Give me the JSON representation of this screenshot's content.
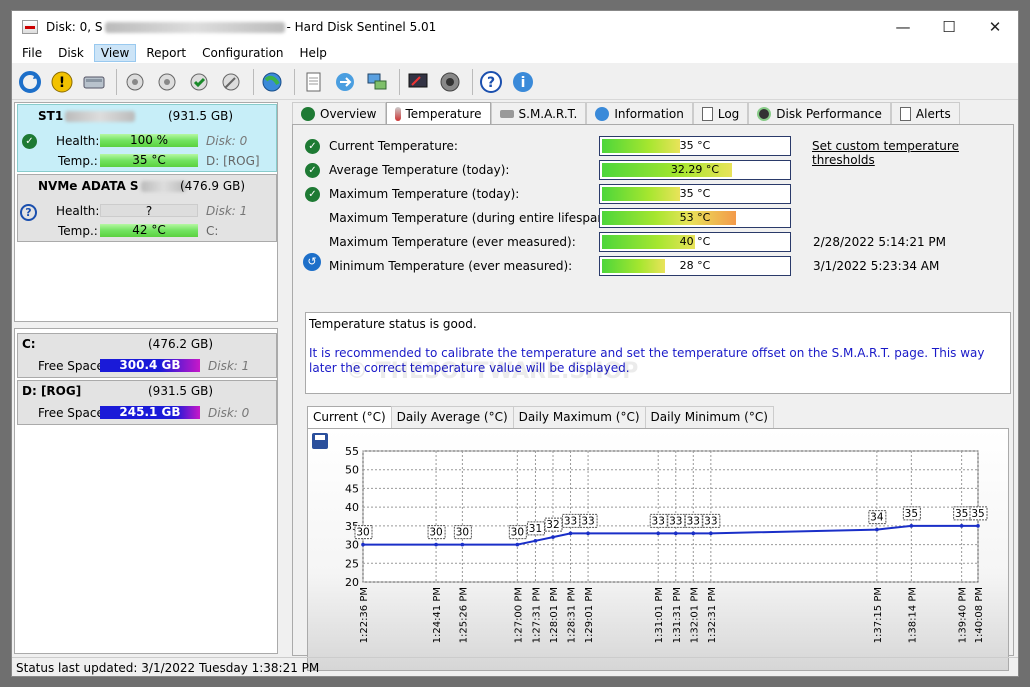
{
  "window": {
    "title_prefix": "Disk: 0, S",
    "title_suffix": "- Hard Disk Sentinel 5.01",
    "min": "—",
    "max": "☐",
    "close": "✕"
  },
  "menu": [
    "File",
    "Disk",
    "View",
    "Report",
    "Configuration",
    "Help"
  ],
  "disks": [
    {
      "title": "ST1",
      "size": "(931.5 GB)",
      "health_label": "Health:",
      "health": "100 %",
      "temp_label": "Temp.:",
      "temp": "35 °C",
      "disk_ref": "Disk: 0",
      "drive": "D: [ROG]"
    },
    {
      "title": "NVMe   ADATA S",
      "size": "(476.9 GB)",
      "health_label": "Health:",
      "health": "?",
      "temp_label": "Temp.:",
      "temp": "42 °C",
      "disk_ref": "Disk: 1",
      "drive": "C:"
    }
  ],
  "volumes": [
    {
      "name": "C:",
      "size": "(476.2 GB)",
      "free_label": "Free Space",
      "free": "300.4 GB",
      "disk_ref": "Disk: 1"
    },
    {
      "name": "D: [ROG]",
      "size": "(931.5 GB)",
      "free_label": "Free Space",
      "free": "245.1 GB",
      "disk_ref": "Disk: 0"
    }
  ],
  "tabs": [
    "Overview",
    "Temperature",
    "S.M.A.R.T.",
    "Information",
    "Log",
    "Disk Performance",
    "Alerts"
  ],
  "temps": [
    {
      "label": "Current Temperature:",
      "value": "35",
      "unit": "°C",
      "fill": 0.42,
      "extra": "Set custom temperature thresholds"
    },
    {
      "label": "Average Temperature (today):",
      "value": "32.29",
      "unit": "°C",
      "fill": 0.7,
      "extra": ""
    },
    {
      "label": "Maximum Temperature (today):",
      "value": "35",
      "unit": "°C",
      "fill": 0.42,
      "extra": ""
    },
    {
      "label": "Maximum Temperature (during entire lifespan):",
      "value": "53",
      "unit": "°C",
      "fill": 0.72,
      "extra": ""
    },
    {
      "label": "Maximum Temperature (ever measured):",
      "value": "40",
      "unit": "°C",
      "fill": 0.5,
      "extra": "2/28/2022 5:14:21 PM"
    },
    {
      "label": "Minimum Temperature (ever measured):",
      "value": "28",
      "unit": "°C",
      "fill": 0.34,
      "extra": "3/1/2022 5:23:34 AM"
    }
  ],
  "status": {
    "line1": "Temperature status is good.",
    "line2": "It is recommended to calibrate the temperature and set the temperature offset on the S.M.A.R.T. page. This way later the correct temperature value will be displayed."
  },
  "watermark": "© THESOFTWARE.SHOP",
  "chart_tabs": [
    "Current (°C)",
    "Daily Average (°C)",
    "Daily Maximum (°C)",
    "Daily Minimum (°C)"
  ],
  "chart_data": {
    "type": "line",
    "ylim": [
      20,
      55
    ],
    "yticks": [
      20,
      25,
      30,
      35,
      40,
      45,
      50,
      55
    ],
    "x": [
      "1:22:36 PM",
      "1:24:41 PM",
      "1:25:26 PM",
      "1:27:00 PM",
      "1:27:31 PM",
      "1:28:01 PM",
      "1:28:31 PM",
      "1:29:01 PM",
      "1:31:01 PM",
      "1:31:31 PM",
      "1:32:01 PM",
      "1:32:31 PM",
      "1:37:15 PM",
      "1:38:14 PM",
      "1:39:40 PM",
      "1:40:08 PM"
    ],
    "x_seconds": [
      0,
      125,
      170,
      264,
      295,
      325,
      355,
      385,
      505,
      535,
      565,
      595,
      879,
      938,
      1024,
      1052
    ],
    "values": [
      30,
      30,
      30,
      30,
      31,
      32,
      33,
      33,
      33,
      33,
      33,
      33,
      34,
      35,
      35,
      35
    ],
    "series_color": "#1a2fc8"
  },
  "statusbar": "Status last updated: 3/1/2022 Tuesday 1:38:21 PM"
}
